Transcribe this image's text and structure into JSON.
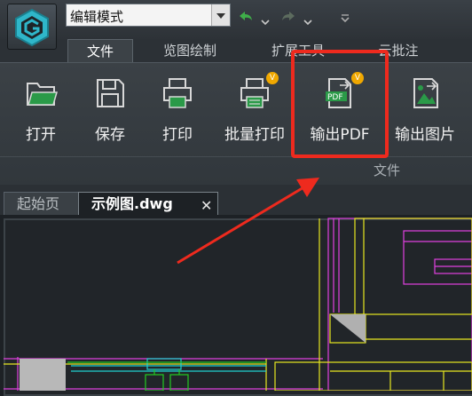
{
  "titlebar": {
    "mode_select": {
      "value": "编辑模式"
    }
  },
  "ribbon_tabs": [
    {
      "label": "文件",
      "active": true
    },
    {
      "label": "览图绘制",
      "active": false
    },
    {
      "label": "扩展工具",
      "active": false
    },
    {
      "label": "云批注",
      "active": false
    }
  ],
  "ribbon": {
    "buttons": [
      {
        "label": "打开",
        "icon": "folder-open-icon"
      },
      {
        "label": "保存",
        "icon": "save-icon"
      },
      {
        "label": "打印",
        "icon": "printer-icon"
      },
      {
        "label": "批量打印",
        "icon": "batch-print-icon"
      },
      {
        "label": "输出PDF",
        "icon": "pdf-export-icon"
      },
      {
        "label": "输出图片",
        "icon": "image-export-icon"
      }
    ],
    "group_label": "文件",
    "pdf_icon_text": "PDF",
    "vip_badge": "V"
  },
  "doc_tabs": [
    {
      "label": "起始页",
      "active": false
    },
    {
      "label": "示例图.dwg",
      "active": true
    }
  ],
  "doc_close": "✕",
  "colors": {
    "highlight": "#ee2a1e",
    "cad_magenta": "#e040e0",
    "cad_yellow": "#e8e820",
    "cad_green": "#22cc22",
    "cad_cyan": "#20d0d0"
  }
}
